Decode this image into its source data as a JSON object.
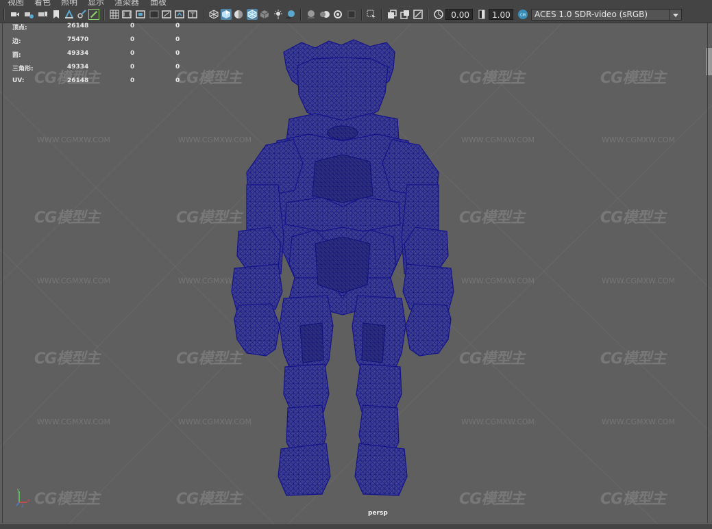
{
  "menu": [
    "视图",
    "着色",
    "照明",
    "显示",
    "渲染器",
    "面板"
  ],
  "toolbar": {
    "exposure_value": "0.00",
    "gamma_value": "1.00",
    "color_space": "ACES 1.0 SDR-video (sRGB)"
  },
  "hud": {
    "rows": [
      {
        "label": "顶点:",
        "value": "26148",
        "c1": "0",
        "c2": "0"
      },
      {
        "label": "边:",
        "value": "75470",
        "c1": "0",
        "c2": "0"
      },
      {
        "label": "面:",
        "value": "49334",
        "c1": "0",
        "c2": "0"
      },
      {
        "label": "三角形:",
        "value": "49334",
        "c1": "0",
        "c2": "0"
      },
      {
        "label": "UV:",
        "value": "26148",
        "c1": "0",
        "c2": "0"
      }
    ]
  },
  "camera_label": "persp",
  "watermark": {
    "logo": "CG模型主",
    "url": "WWW.CGMXW.COM"
  },
  "colors": {
    "viewport_bg": "#5f5f5f",
    "wireframe": "#1c1c8c",
    "mesh_fill": "#3e3f8e",
    "toolbar_bg": "#444444",
    "active_icon": "#5285a6"
  },
  "icons": [
    "camera-icon",
    "camera-attributes-icon",
    "bookmark-icon",
    "image-plane-icon",
    "2d-pan-icon",
    "grease-pencil-icon",
    "grid-icon",
    "film-gate-icon",
    "resolution-gate-icon",
    "gate-mask-icon",
    "field-chart-icon",
    "safe-title-icon",
    "wireframe-icon",
    "smooth-shade-icon",
    "default-material-icon",
    "wireframe-on-shaded-icon",
    "textured-icon",
    "use-all-lights-icon",
    "shadows-icon",
    "screen-space-ao-icon",
    "motion-blur-icon",
    "multisample-aa-icon",
    "depth-of-field-icon",
    "isolate-select-icon",
    "xray-icon",
    "xray-joints-icon",
    "xray-components-icon",
    "exposure-icon",
    "gamma-icon",
    "color-management-icon"
  ]
}
